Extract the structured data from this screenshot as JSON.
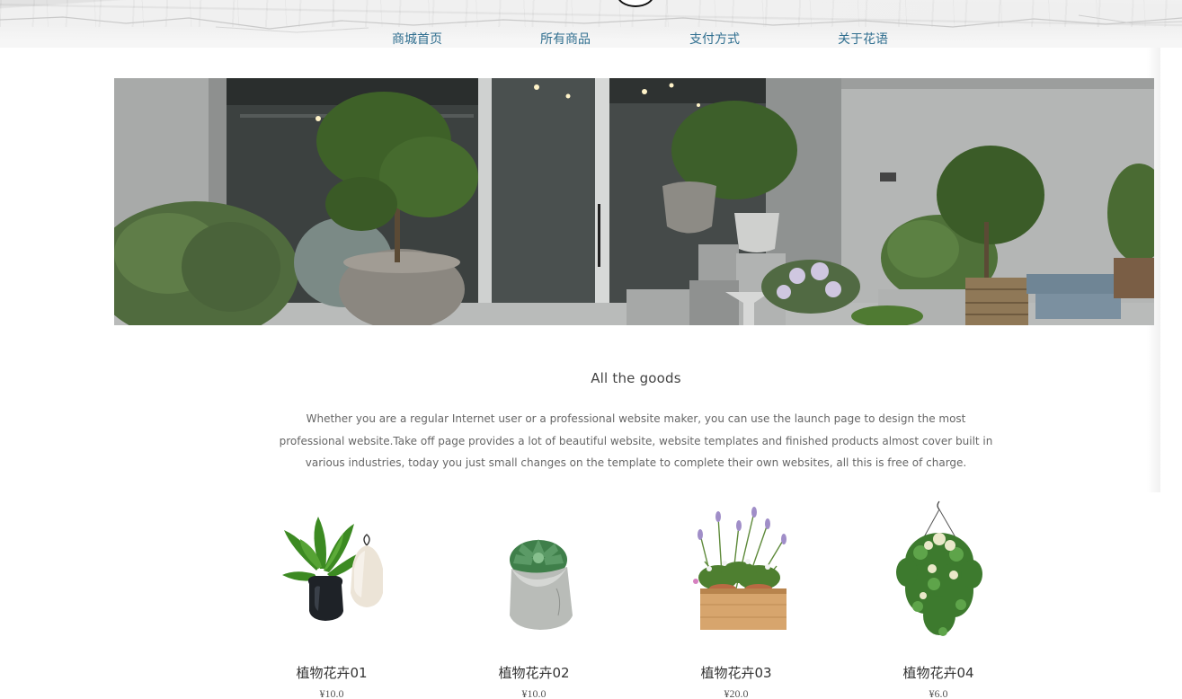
{
  "nav": {
    "items": [
      {
        "label": "商城首页"
      },
      {
        "label": "所有商品"
      },
      {
        "label": "支付方式"
      },
      {
        "label": "关于花语"
      }
    ]
  },
  "section": {
    "title": "All the goods",
    "description": "Whether you are a regular Internet user or a professional website maker, you can use the launch page to design the most professional website.Take off page provides a lot of beautiful website, website templates and finished products almost cover built in various industries, today you just small changes on the template to complete their own websites, all this is free of charge."
  },
  "products": [
    {
      "name": "植物花卉01",
      "price": "¥10.0",
      "icon": "potted-plant-ceramic-icon"
    },
    {
      "name": "植物花卉02",
      "price": "¥10.0",
      "icon": "succulent-paper-bag-icon"
    },
    {
      "name": "植物花卉03",
      "price": "¥20.0",
      "icon": "lavender-wooden-box-icon"
    },
    {
      "name": "植物花卉04",
      "price": "¥6.0",
      "icon": "hanging-basket-plant-icon"
    }
  ],
  "colors": {
    "nav_link": "#2f6e8f",
    "title_text": "#444444",
    "body_text": "#666666"
  }
}
